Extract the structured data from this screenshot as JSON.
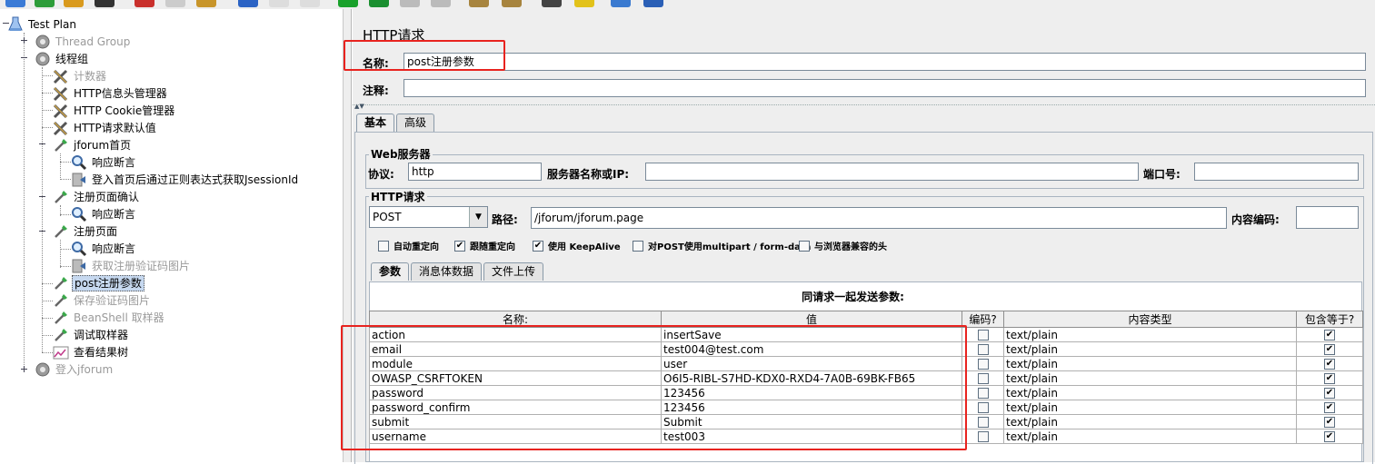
{
  "tree": {
    "items": [
      {
        "label": "Test Plan",
        "icon": "test-plan-icon",
        "dim": false
      },
      {
        "label": "Thread Group",
        "icon": "gear-icon",
        "dim": true
      },
      {
        "label": "线程组",
        "icon": "gear-icon",
        "dim": false
      },
      {
        "label": "计数器",
        "icon": "wrench-icon",
        "dim": true
      },
      {
        "label": "HTTP信息头管理器",
        "icon": "wrench-icon",
        "dim": false
      },
      {
        "label": "HTTP Cookie管理器",
        "icon": "wrench-icon",
        "dim": false
      },
      {
        "label": "HTTP请求默认值",
        "icon": "wrench-icon",
        "dim": false
      },
      {
        "label": "jforum首页",
        "icon": "pipette-icon",
        "dim": false
      },
      {
        "label": "响应断言",
        "icon": "magnifier-icon",
        "dim": false
      },
      {
        "label": "登入首页后通过正则表达式获取JsessionId",
        "icon": "extractor-icon",
        "dim": false
      },
      {
        "label": "注册页面确认",
        "icon": "pipette-icon",
        "dim": false
      },
      {
        "label": "响应断言",
        "icon": "magnifier-icon",
        "dim": false
      },
      {
        "label": "注册页面",
        "icon": "pipette-icon",
        "dim": false
      },
      {
        "label": "响应断言",
        "icon": "magnifier-icon",
        "dim": false
      },
      {
        "label": "获取注册验证码图片",
        "icon": "extractor-icon",
        "dim": true
      },
      {
        "label": "post注册参数",
        "icon": "pipette-icon",
        "dim": false
      },
      {
        "label": "保存验证码图片",
        "icon": "pipette-icon",
        "dim": true
      },
      {
        "label": "BeanShell 取样器",
        "icon": "pipette-icon",
        "dim": true
      },
      {
        "label": "调试取样器",
        "icon": "pipette-icon",
        "dim": false
      },
      {
        "label": "查看结果树",
        "icon": "chart-icon",
        "dim": false
      },
      {
        "label": "登入jforum",
        "icon": "gear-icon",
        "dim": true
      }
    ]
  },
  "panel": {
    "title": "HTTP请求",
    "name_label": "名称:",
    "name_value": "post注册参数",
    "comment_label": "注释:",
    "comment_value": ""
  },
  "tabs": {
    "basic": "基本",
    "advanced": "高级"
  },
  "web_server": {
    "group_title": "Web服务器",
    "protocol_label": "协议:",
    "protocol_value": "http",
    "server_label": "服务器名称或IP:",
    "server_value": "",
    "port_label": "端口号:",
    "port_value": ""
  },
  "http_request": {
    "group_title": "HTTP请求",
    "method": "POST",
    "path_label": "路径:",
    "path_value": "/jforum/jforum.page",
    "encoding_label": "内容编码:",
    "encoding_value": "",
    "options": [
      {
        "label": "自动重定向",
        "checked": false
      },
      {
        "label": "跟随重定向",
        "checked": true
      },
      {
        "label": "使用 KeepAlive",
        "checked": true
      },
      {
        "label": "对POST使用multipart / form-data",
        "checked": false
      },
      {
        "label": "与浏览器兼容的头",
        "checked": false
      }
    ]
  },
  "sub_tabs": {
    "params": "参数",
    "body": "消息体数据",
    "upload": "文件上传"
  },
  "params_table": {
    "title": "同请求一起发送参数:",
    "headers": {
      "name": "名称:",
      "value": "值",
      "encode": "编码?",
      "content_type": "内容类型",
      "include_equals": "包含等于?"
    },
    "rows": [
      {
        "name": "action",
        "value": "insertSave",
        "encode": false,
        "content_type": "text/plain",
        "include_equals": true
      },
      {
        "name": "email",
        "value": "test004@test.com",
        "encode": false,
        "content_type": "text/plain",
        "include_equals": true
      },
      {
        "name": "module",
        "value": "user",
        "encode": false,
        "content_type": "text/plain",
        "include_equals": true
      },
      {
        "name": "OWASP_CSRFTOKEN",
        "value": "O6I5-RIBL-S7HD-KDX0-RXD4-7A0B-69BK-FB65",
        "encode": false,
        "content_type": "text/plain",
        "include_equals": true
      },
      {
        "name": "password",
        "value": "123456",
        "encode": false,
        "content_type": "text/plain",
        "include_equals": true
      },
      {
        "name": "password_confirm",
        "value": "123456",
        "encode": false,
        "content_type": "text/plain",
        "include_equals": true
      },
      {
        "name": "submit",
        "value": "Submit",
        "encode": false,
        "content_type": "text/plain",
        "include_equals": true
      },
      {
        "name": "username",
        "value": "test003",
        "encode": false,
        "content_type": "text/plain",
        "include_equals": true
      }
    ]
  },
  "colors": {
    "highlight_box": "#e8231f",
    "selection": "#c6d8ef"
  }
}
